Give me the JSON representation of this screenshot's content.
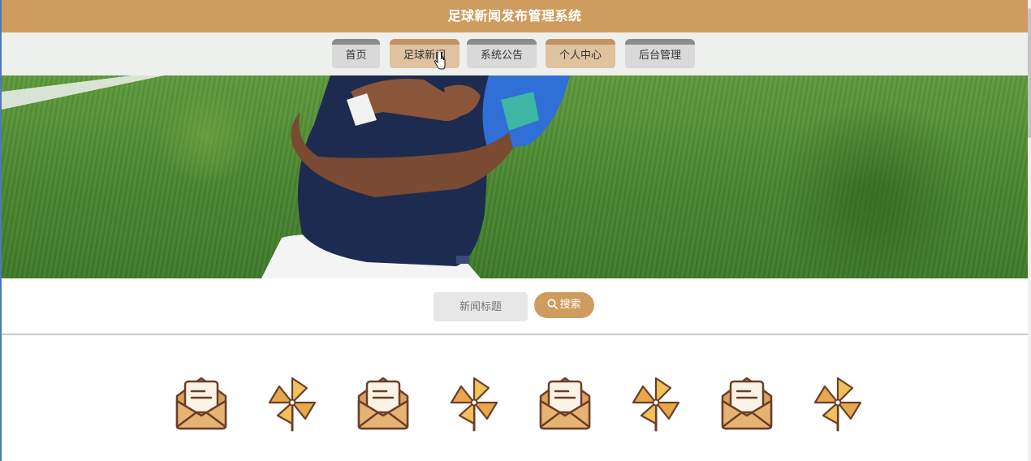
{
  "app": {
    "title": "足球新闻发布管理系统"
  },
  "nav": [
    {
      "label": "首页",
      "style": "gray"
    },
    {
      "label": "足球新闻",
      "style": "tan"
    },
    {
      "label": "系统公告",
      "style": "gray"
    },
    {
      "label": "个人中心",
      "style": "tan"
    },
    {
      "label": "后台管理",
      "style": "gray"
    }
  ],
  "search": {
    "placeholder": "新闻标题",
    "button_label": "搜索"
  },
  "icons": [
    "envelope-icon",
    "pinwheel-icon",
    "envelope-icon",
    "pinwheel-icon",
    "envelope-icon",
    "pinwheel-icon",
    "envelope-icon",
    "pinwheel-icon"
  ],
  "colors": {
    "accent": "#cf9c60",
    "nav_background": "#eef0ed",
    "nav_tab_gray": "#d9d9d9",
    "nav_tab_tan": "#dfc29f"
  }
}
